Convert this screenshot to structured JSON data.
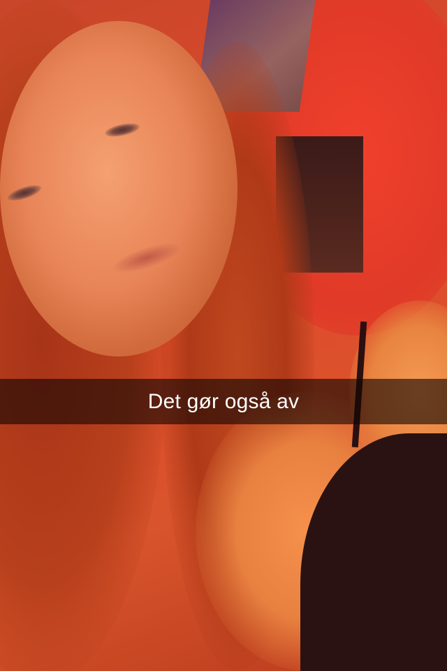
{
  "snap": {
    "caption": "Det gør også av"
  },
  "colors": {
    "caption_bar": "#140604",
    "caption_text": "#ffffff",
    "wall": "#e03a28"
  }
}
